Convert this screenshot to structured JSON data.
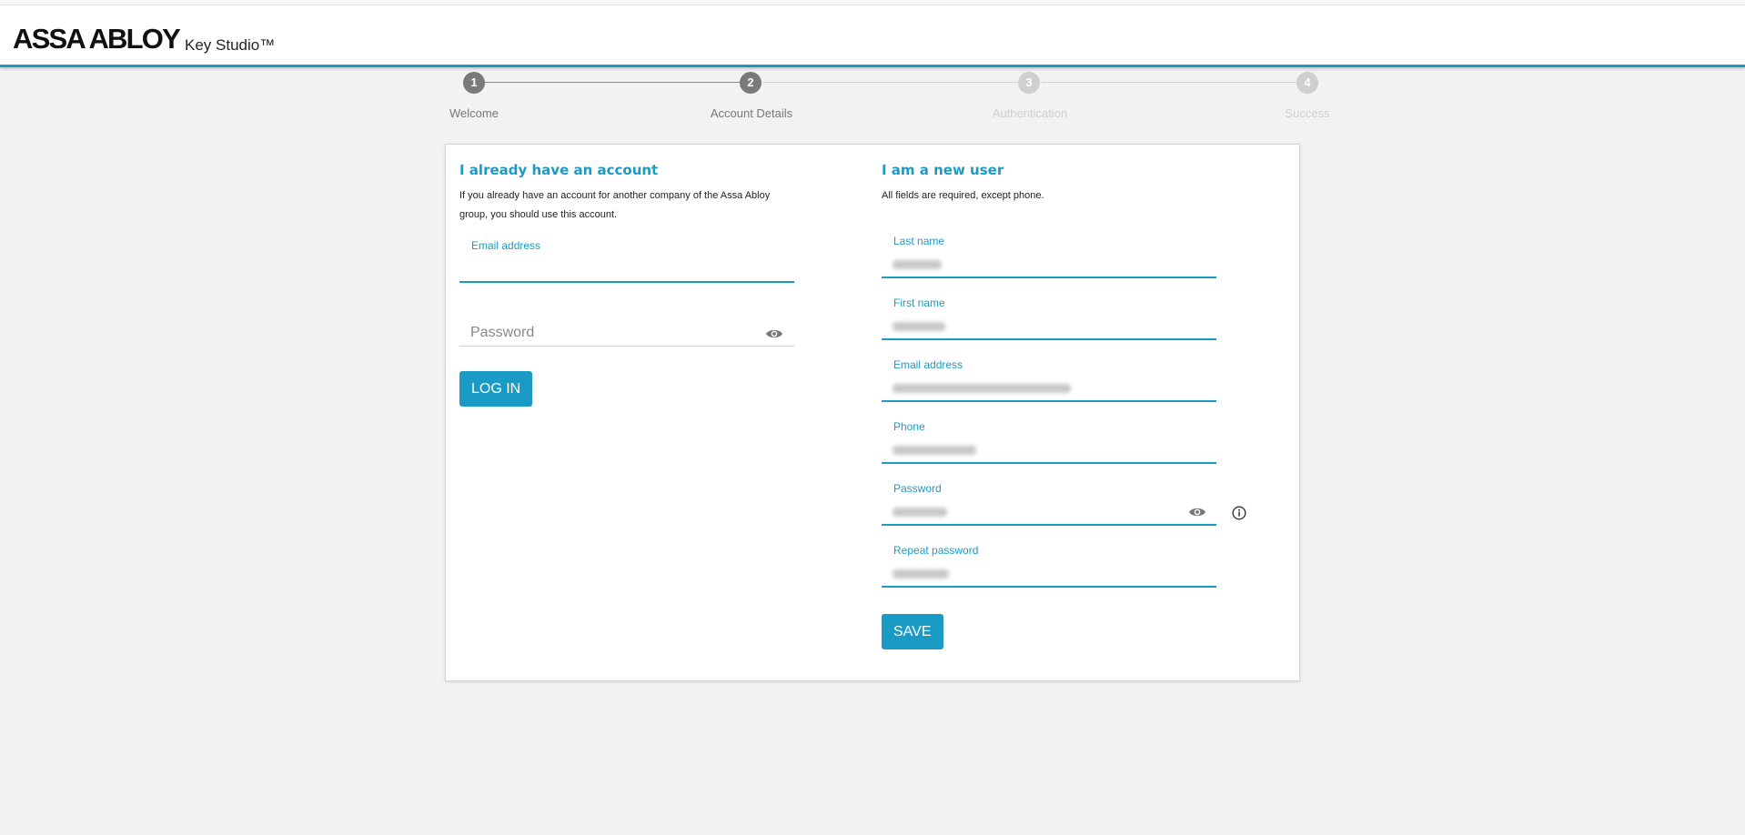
{
  "header": {
    "brand": "ASSA ABLOY",
    "product": "Key Studio™"
  },
  "stepper": {
    "steps": [
      {
        "number": "1",
        "label": "Welcome",
        "state": "done"
      },
      {
        "number": "2",
        "label": "Account Details",
        "state": "active"
      },
      {
        "number": "3",
        "label": "Authentication",
        "state": "pending"
      },
      {
        "number": "4",
        "label": "Success",
        "state": "pending"
      }
    ]
  },
  "existing": {
    "title": "I already have an account",
    "description": "If you already have an account for another company of the Assa Abloy group, you should use this account.",
    "email_label": "Email address",
    "email_value": "",
    "password_placeholder": "Password",
    "password_value": "",
    "login_label": "LOG IN"
  },
  "new_user": {
    "title": "I am a new user",
    "description": "All fields are required, except phone.",
    "fields": [
      {
        "label": "Last name",
        "value_redacted": true
      },
      {
        "label": "First name",
        "value_redacted": true
      },
      {
        "label": "Email address",
        "value_redacted": true
      },
      {
        "label": "Phone",
        "value_redacted": true
      },
      {
        "label": "Password",
        "value_redacted": true
      },
      {
        "label": "Repeat password",
        "value_redacted": true
      }
    ],
    "save_label": "SAVE"
  },
  "colors": {
    "accent": "#1a9bc6",
    "step_active": "#7a7a7a",
    "step_pending": "#cfcfcf"
  },
  "icons": {
    "show_password": "eye-icon",
    "password_info": "info-icon"
  }
}
